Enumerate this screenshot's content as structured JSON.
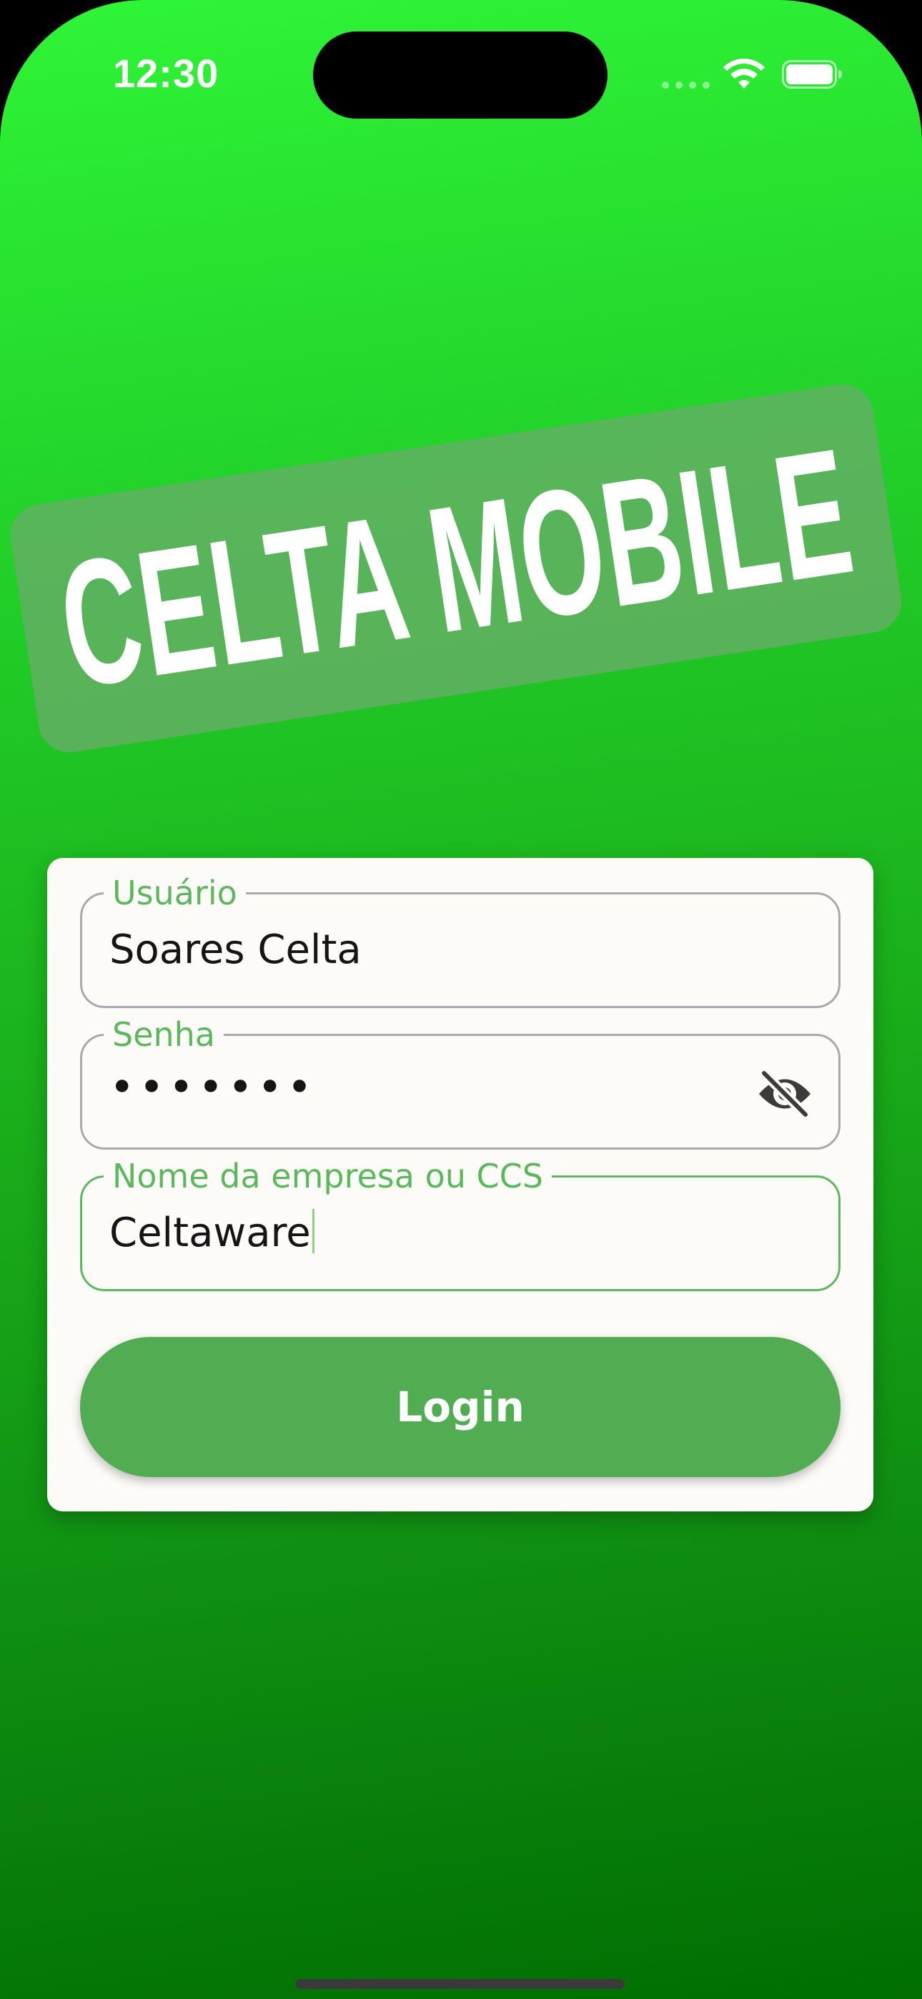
{
  "status_bar": {
    "time": "12:30",
    "icons": [
      "cellular-signal-icon",
      "wifi-icon",
      "battery-icon"
    ]
  },
  "logo": {
    "text": "CELTA MOBILE"
  },
  "login_form": {
    "username": {
      "label": "Usuário",
      "value": "Soares Celta"
    },
    "password": {
      "label": "Senha",
      "value": "•••••••",
      "toggle_icon": "eye-off-icon"
    },
    "company": {
      "label": "Nome da empresa ou CCS",
      "value": "Celtaware"
    },
    "login_label": "Login"
  },
  "colors": {
    "gradient_top": "#2ef536",
    "gradient_bottom": "#006e02",
    "accent": "#5cb85c",
    "button": "#52ad52",
    "card": "#fcfbf7"
  }
}
